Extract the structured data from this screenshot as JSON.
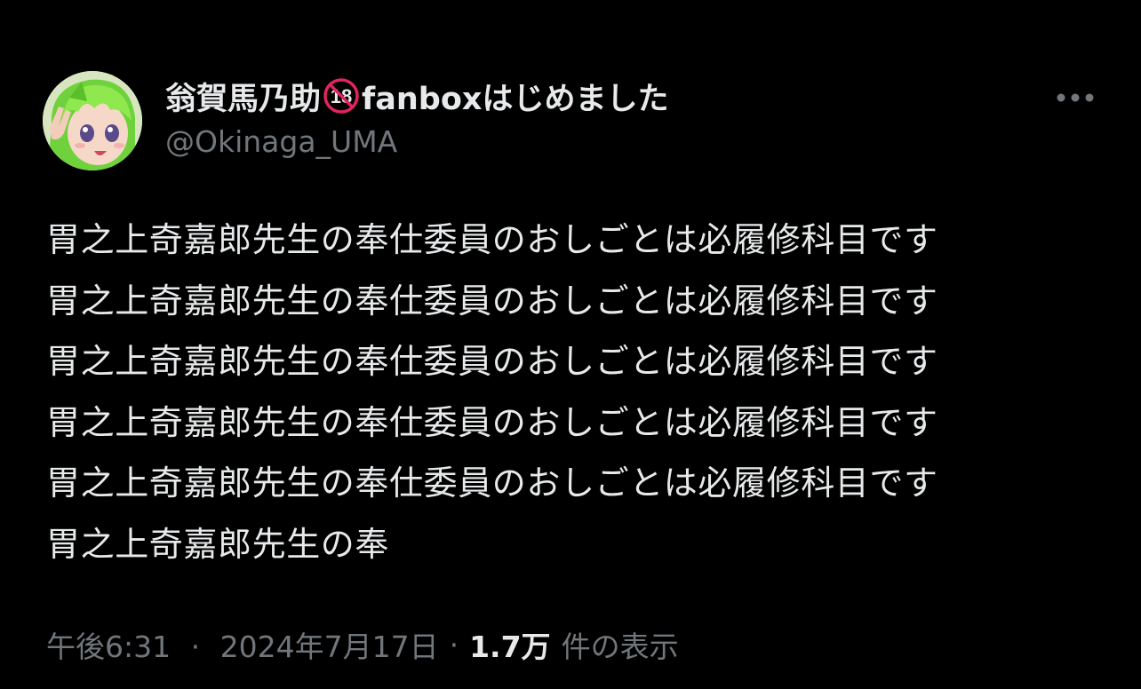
{
  "author": {
    "display_name": "翁賀馬乃助",
    "display_name_suffix": "fanboxはじめました",
    "badge_text": "18",
    "badge_icon": "no-under-18-icon",
    "handle": "@Okinaga_UMA",
    "avatar": "anime-avatar-green-hair"
  },
  "menu": {
    "icon": "more-horizontal-icon"
  },
  "post": {
    "lines": [
      "胃之上奇嘉郎先生の奉仕委員のおしごとは必履修科目です",
      "胃之上奇嘉郎先生の奉仕委員のおしごとは必履修科目です",
      "胃之上奇嘉郎先生の奉仕委員のおしごとは必履修科目です",
      "胃之上奇嘉郎先生の奉仕委員のおしごとは必履修科目です",
      "胃之上奇嘉郎先生の奉仕委員のおしごとは必履修科目です",
      "胃之上奇嘉郎先生の奉"
    ]
  },
  "meta": {
    "time": "午後6:31",
    "separator": "·",
    "date": "2024年7月17日",
    "views_count": "1.7万",
    "views_label": "件の表示"
  },
  "colors": {
    "background": "#000000",
    "primary_text": "#e7e9ea",
    "secondary_text": "#71767b",
    "badge_red": "#e0245e"
  }
}
